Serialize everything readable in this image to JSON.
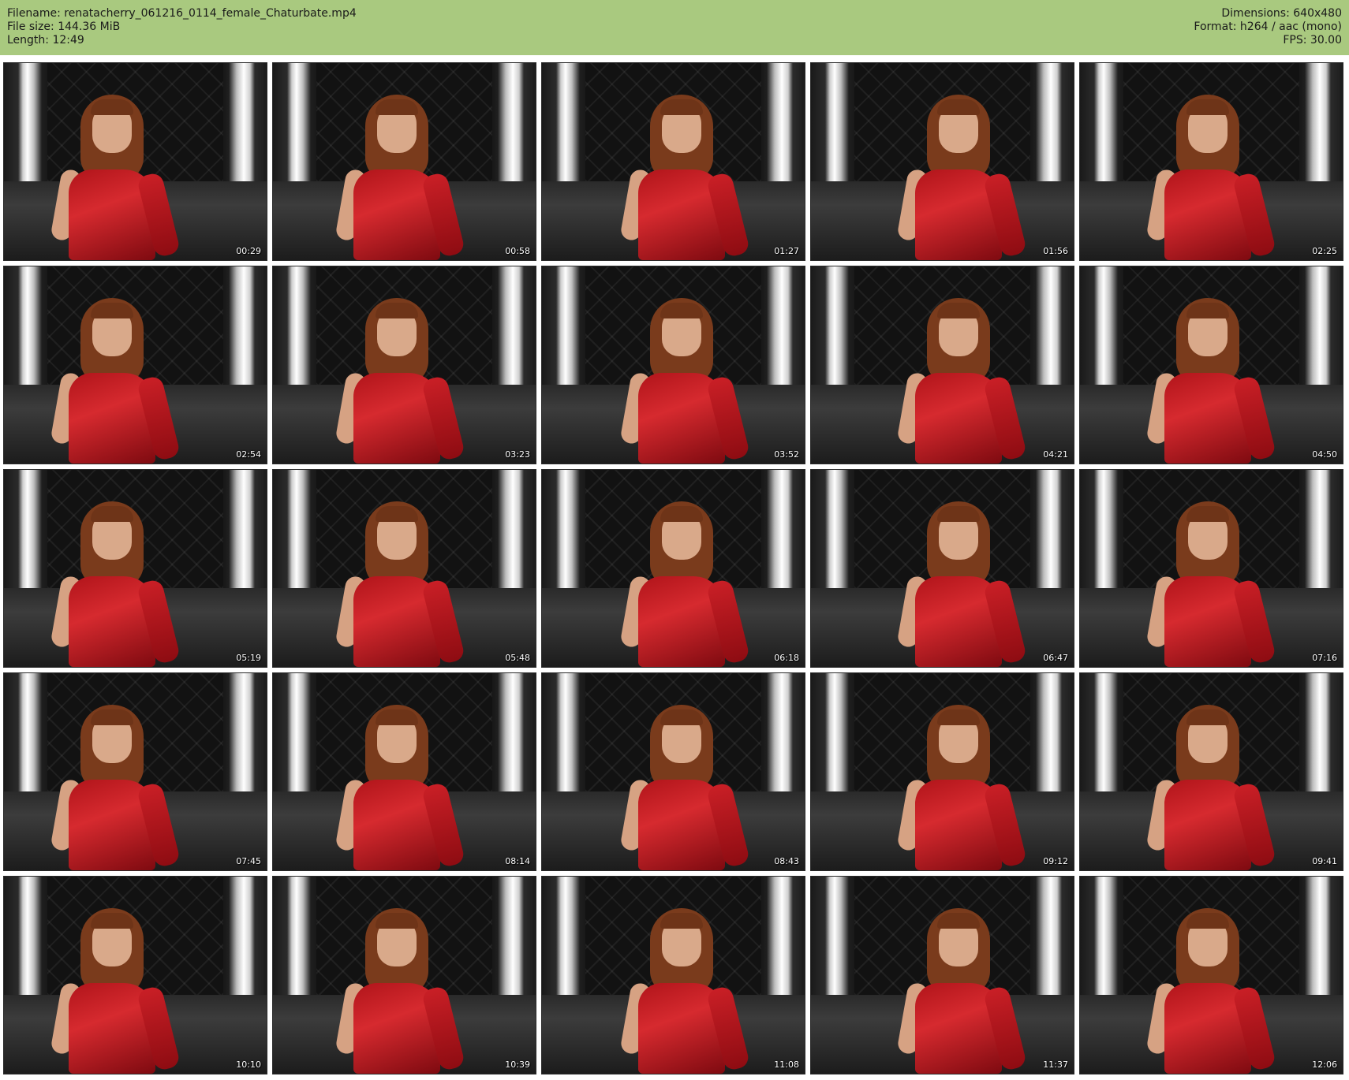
{
  "header": {
    "filename_line": "Filename: renatacherry_061216_0114_female_Chaturbate.mp4",
    "filesize_line": "File size: 144.36 MiB",
    "length_line": "Length: 12:49",
    "dimensions_line": "Dimensions: 640x480",
    "format_line": "Format: h264 / aac (mono)",
    "fps_line": "FPS: 30.00"
  },
  "thumbnails": [
    {
      "time": "00:29"
    },
    {
      "time": "00:58"
    },
    {
      "time": "01:27"
    },
    {
      "time": "01:56"
    },
    {
      "time": "02:25"
    },
    {
      "time": "02:54"
    },
    {
      "time": "03:23"
    },
    {
      "time": "03:52"
    },
    {
      "time": "04:21"
    },
    {
      "time": "04:50"
    },
    {
      "time": "05:19"
    },
    {
      "time": "05:48"
    },
    {
      "time": "06:18"
    },
    {
      "time": "06:47"
    },
    {
      "time": "07:16"
    },
    {
      "time": "07:45"
    },
    {
      "time": "08:14"
    },
    {
      "time": "08:43"
    },
    {
      "time": "09:12"
    },
    {
      "time": "09:41"
    },
    {
      "time": "10:10"
    },
    {
      "time": "10:39"
    },
    {
      "time": "11:08"
    },
    {
      "time": "11:37"
    },
    {
      "time": "12:06"
    }
  ],
  "colors": {
    "header_bg": "#a9c97f",
    "dress": "#c41e24",
    "hair": "#7a3b1c"
  }
}
